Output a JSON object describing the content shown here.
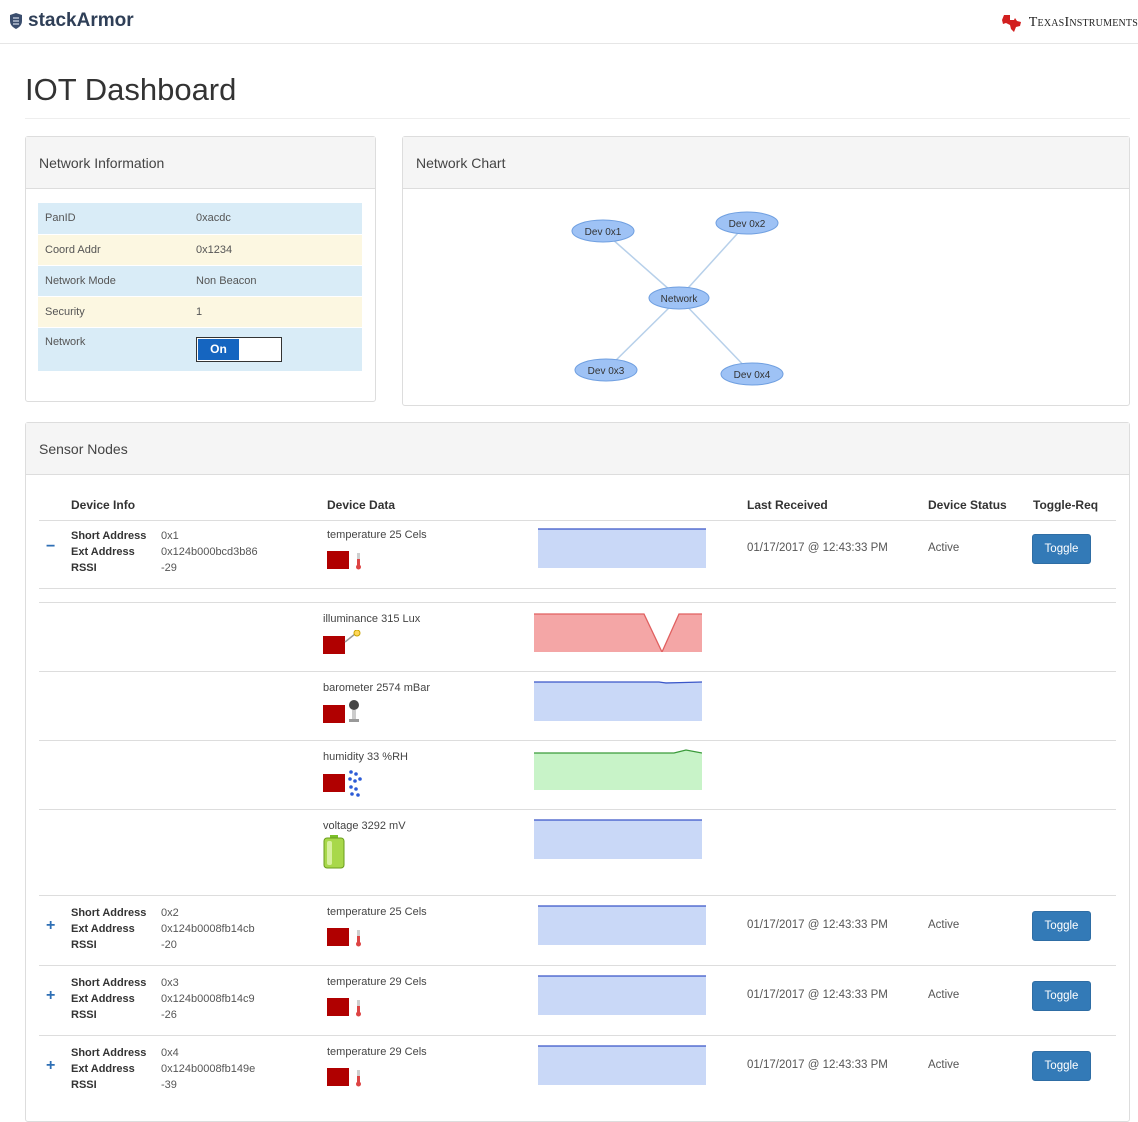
{
  "header": {
    "brand": "stackArmor",
    "partner_first": "Texas ",
    "partner_second": "Instruments"
  },
  "page_title": "IOT Dashboard",
  "network_info": {
    "title": "Network Information",
    "rows": [
      {
        "key": "PanID",
        "value": "0xacdc"
      },
      {
        "key": "Coord Addr",
        "value": "0x1234"
      },
      {
        "key": "Network Mode",
        "value": "Non Beacon"
      },
      {
        "key": "Security",
        "value": "1"
      }
    ],
    "network_label": "Network",
    "network_toggle": "On"
  },
  "network_chart": {
    "title": "Network Chart",
    "hub": "Network",
    "nodes": [
      "Dev 0x1",
      "Dev 0x2",
      "Dev 0x3",
      "Dev 0x4"
    ]
  },
  "sensor_nodes": {
    "title": "Sensor Nodes",
    "columns": [
      "Device Info",
      "Device Data",
      "Last Received",
      "Device Status",
      "Toggle-Req"
    ],
    "address_labels": [
      "Short Address",
      "Ext Address",
      "RSSI"
    ],
    "toggle_label": "Toggle",
    "devices": [
      {
        "short": "0x1",
        "ext": "0x124b000bcd3b86",
        "rssi": "-29",
        "expander": "−",
        "reading": "temperature 25 Cels",
        "last": "01/17/2017 @ 12:43:33 PM",
        "status": "Active"
      },
      {
        "short": "0x2",
        "ext": "0x124b0008fb14cb",
        "rssi": "-20",
        "expander": "+",
        "reading": "temperature 25 Cels",
        "last": "01/17/2017 @ 12:43:33 PM",
        "status": "Active"
      },
      {
        "short": "0x3",
        "ext": "0x124b0008fb14c9",
        "rssi": "-26",
        "expander": "+",
        "reading": "temperature 29 Cels",
        "last": "01/17/2017 @ 12:43:33 PM",
        "status": "Active"
      },
      {
        "short": "0x4",
        "ext": "0x124b0008fb149e",
        "rssi": "-39",
        "expander": "+",
        "reading": "temperature 29 Cels",
        "last": "01/17/2017 @ 12:43:33 PM",
        "status": "Active"
      }
    ],
    "expanded_readings": [
      {
        "reading": "illuminance 315 Lux",
        "icon": "light-bulb-icon",
        "color": "#f08080"
      },
      {
        "reading": "barometer 2574 mBar",
        "icon": "barometer-icon",
        "color": "#8aa8f0"
      },
      {
        "reading": "humidity 33 %RH",
        "icon": "water-drops-icon",
        "color": "#6cc26c"
      },
      {
        "reading": "voltage 3292 mV",
        "icon": "battery-icon",
        "color": "#8aa8f0"
      }
    ]
  },
  "colors": {
    "accent": "#337ab7",
    "toggle_on": "#1565c0",
    "node_fill": "#9ec2f5",
    "sensor_red": "#b00000"
  }
}
